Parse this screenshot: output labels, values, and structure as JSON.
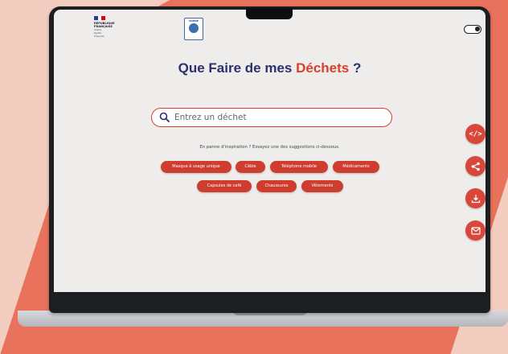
{
  "colors": {
    "accent": "#d8402e",
    "title_navy": "#2e2f6e",
    "chip": "#cf3d2e",
    "background": "#f3cdbf"
  },
  "logos": {
    "republique": {
      "lines": [
        "RÉPUBLIQUE",
        "FRANÇAISE"
      ],
      "motto": [
        "Liberté",
        "Égalité",
        "Fraternité"
      ]
    },
    "ademe": {
      "label": "ADEME"
    }
  },
  "header": {
    "title_part1": "Que Faire de mes",
    "title_accent": "Déchets",
    "title_part2": "?"
  },
  "search": {
    "placeholder": "Entrez un déchet",
    "icon": "search-icon"
  },
  "suggestions": {
    "hint": "En panne d'inspiration ? Essayez une des suggestions ci-dessous.",
    "chips": [
      "Masque à usage unique",
      "Câble",
      "Téléphone mobile",
      "Médicaments",
      "Capsules de café",
      "Chaussures",
      "Vêtements"
    ]
  },
  "side_buttons": [
    {
      "name": "embed-code-icon",
      "glyph": "</>"
    },
    {
      "name": "share-icon"
    },
    {
      "name": "download-icon"
    },
    {
      "name": "mail-icon"
    }
  ]
}
